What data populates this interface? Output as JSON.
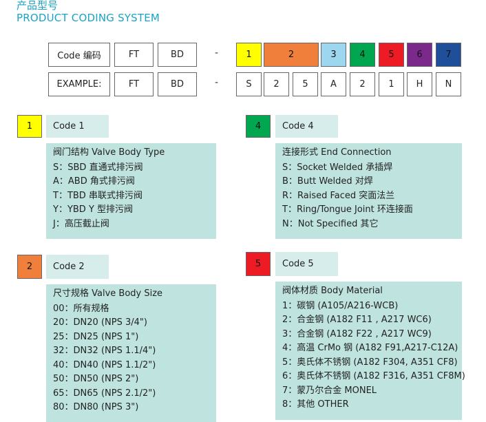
{
  "header": {
    "title_cn": "产品型号",
    "title_en": "PRODUCT CODING SYSTEM"
  },
  "colors": {
    "c1": "#ffff00",
    "c2": "#f07f3c",
    "c3": "#9dd6ef",
    "c4": "#00a650",
    "c5": "#ed1c24",
    "c6": "#7b2a8c",
    "c7": "#1f4e9b",
    "tab_bg": "#d7edec",
    "panel_bg": "#bfe3df",
    "title": "#1aa3c4"
  },
  "code_row": {
    "label": "Code 编码",
    "ft": "FT",
    "bd": "BD",
    "dash": "-",
    "slots": [
      "1",
      "2",
      "3",
      "4",
      "5",
      "6",
      "7"
    ]
  },
  "example_row": {
    "label": "EXAMPLE:",
    "ft": "FT",
    "bd": "BD",
    "dash": "-",
    "slots": [
      "S",
      "2",
      "5",
      "A",
      "2",
      "1",
      "H",
      "N"
    ]
  },
  "sections": {
    "code1": {
      "num": "1",
      "title": "Code 1",
      "lines": [
        "阀门结构 Valve Body Type",
        "S：SBD 直通式排污阀",
        "A：ABD 角式排污阀",
        "T：TBD 串联式排污阀",
        "Y：YBD Y 型排污阀",
        "J：高压截止阀"
      ]
    },
    "code2": {
      "num": "2",
      "title": "Code 2",
      "lines": [
        "尺寸规格 Valve Body Size",
        "00：所有规格",
        "20：DN20 (NPS 3/4\")",
        "25：DN25 (NPS 1\")",
        "32：DN32 (NPS 1.1/4\")",
        "40：DN40 (NPS 1.1/2\")",
        "50：DN50 (NPS 2\")",
        "65：DN65 (NPS 2.1/2\")",
        "80：DN80 (NPS 3\")"
      ]
    },
    "code4": {
      "num": "4",
      "title": "Code 4",
      "lines": [
        "连接形式 End Connection",
        "S：Socket Welded 承插焊",
        "B：Butt Welded 对焊",
        "R：Raised Faced 突面法兰",
        "T：Ring/Tongue Joint 环连接面",
        "N：Not Specified 其它"
      ]
    },
    "code5": {
      "num": "5",
      "title": "Code 5",
      "lines": [
        "阀体材质 Body Material",
        "1：碳钢 (A105/A216-WCB)",
        "2：合金钢 (A182 F11 , A217 WC6)",
        "3：合金钢 (A182 F22 , A217 WC9)",
        "4：高温 CrMo 钢 (A182 F91,A217-C12A)",
        "5：奥氏体不锈钢 (A182 F304, A351 CF8)",
        "6：奥氏体不锈钢 (A182 F316, A351 CF8M)",
        "7：蒙乃尔合金 MONEL",
        "8：其他 OTHER"
      ]
    }
  }
}
